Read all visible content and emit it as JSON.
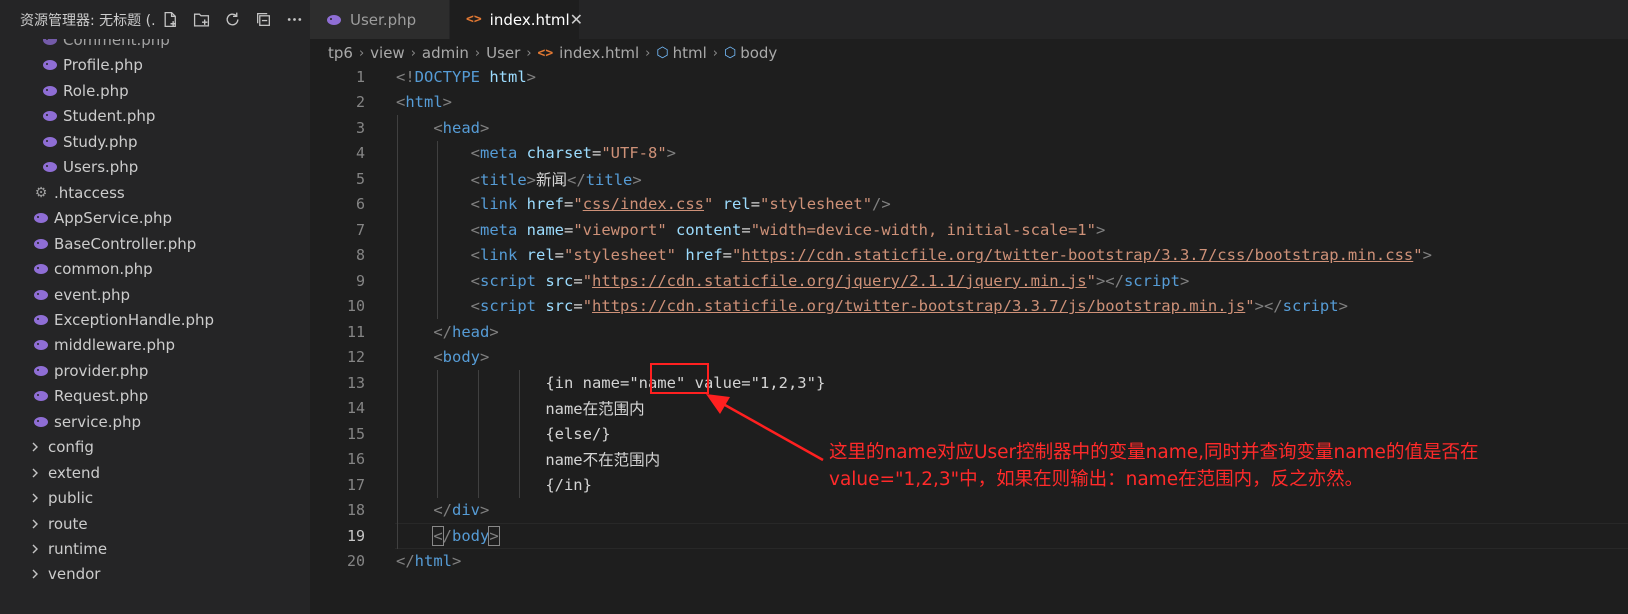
{
  "sidebar": {
    "title": "资源管理器: 无标题 (...",
    "actions": [
      {
        "icon": "new-file-icon"
      },
      {
        "icon": "new-folder-icon"
      },
      {
        "icon": "refresh-icon"
      },
      {
        "icon": "collapse-all-icon"
      },
      {
        "icon": "more-icon"
      }
    ],
    "items": [
      {
        "label": "Comment.php",
        "icon": "php-elephant-icon",
        "depth": 2
      },
      {
        "label": "Profile.php",
        "icon": "php-elephant-icon",
        "depth": 2
      },
      {
        "label": "Role.php",
        "icon": "php-elephant-icon",
        "depth": 2
      },
      {
        "label": "Student.php",
        "icon": "php-elephant-icon",
        "depth": 2
      },
      {
        "label": "Study.php",
        "icon": "php-elephant-icon",
        "depth": 2
      },
      {
        "label": "Users.php",
        "icon": "php-elephant-icon",
        "depth": 2
      },
      {
        "label": ".htaccess",
        "icon": "gear-icon",
        "depth": 1
      },
      {
        "label": "AppService.php",
        "icon": "php-elephant-icon",
        "depth": 1
      },
      {
        "label": "BaseController.php",
        "icon": "php-elephant-icon",
        "depth": 1
      },
      {
        "label": "common.php",
        "icon": "php-elephant-icon",
        "depth": 1
      },
      {
        "label": "event.php",
        "icon": "php-elephant-icon",
        "depth": 1
      },
      {
        "label": "ExceptionHandle.php",
        "icon": "php-elephant-icon",
        "depth": 1
      },
      {
        "label": "middleware.php",
        "icon": "php-elephant-icon",
        "depth": 1
      },
      {
        "label": "provider.php",
        "icon": "php-elephant-icon",
        "depth": 1
      },
      {
        "label": "Request.php",
        "icon": "php-elephant-icon",
        "depth": 1
      },
      {
        "label": "service.php",
        "icon": "php-elephant-icon",
        "depth": 1
      },
      {
        "label": "config",
        "icon": "chevron-right-icon",
        "depth": 0
      },
      {
        "label": "extend",
        "icon": "chevron-right-icon",
        "depth": 0
      },
      {
        "label": "public",
        "icon": "chevron-right-icon",
        "depth": 0
      },
      {
        "label": "route",
        "icon": "chevron-right-icon",
        "depth": 0
      },
      {
        "label": "runtime",
        "icon": "chevron-right-icon",
        "depth": 0
      },
      {
        "label": "vendor",
        "icon": "chevron-right-icon",
        "depth": 0
      }
    ]
  },
  "tabs": [
    {
      "label": "User.php",
      "icon": "php-elephant-icon",
      "active": false
    },
    {
      "label": "index.html",
      "icon": "html-icon",
      "active": true,
      "close": "✕"
    }
  ],
  "breadcrumb": [
    "tp6",
    "view",
    "admin",
    "User",
    "index.html",
    "html",
    "body"
  ],
  "editor": {
    "current_line": 19,
    "lines": [
      "1",
      "2",
      "3",
      "4",
      "5",
      "6",
      "7",
      "8",
      "9",
      "10",
      "11",
      "12",
      "13",
      "14",
      "15",
      "16",
      "17",
      "18",
      "19",
      "20"
    ]
  },
  "annotation": {
    "line1": "这里的name对应User控制器中的变量name,同时并查询变量name的值是否在",
    "line2": "value=\"1,2,3\"中，如果在则输出：name在范围内，反之亦然。",
    "color": "#ff2a2a"
  },
  "colors": {
    "tag": "#569cd6",
    "attr": "#9cdcfe",
    "string": "#ce9178",
    "background": "#1e1e1e",
    "sidebar": "#252526"
  }
}
